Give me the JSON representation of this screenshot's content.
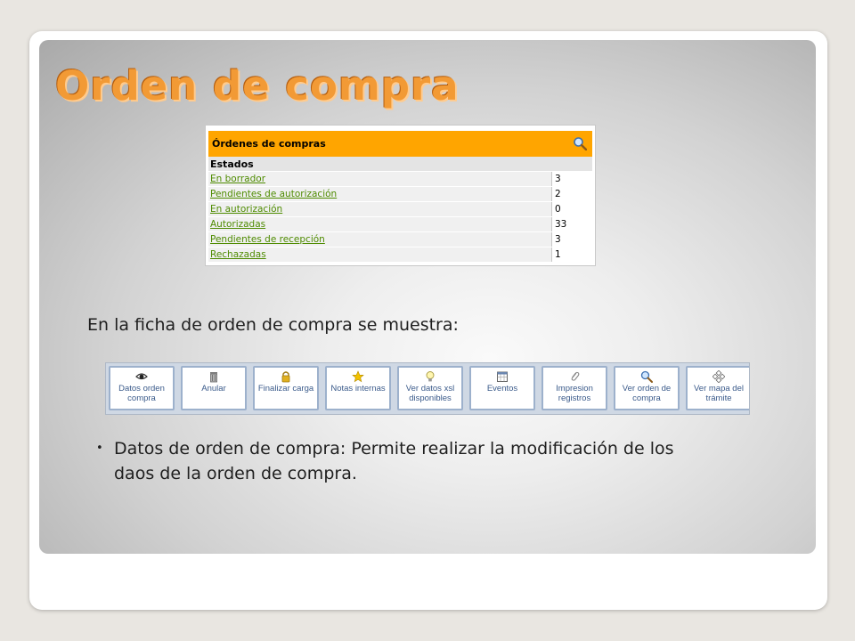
{
  "slide": {
    "title": "Orden de compra",
    "subtitle": "En la ficha de orden de compra se muestra:",
    "bullet": "Datos de orden de compra: Permite realizar la modificación de los daos de la orden de compra."
  },
  "orders_panel": {
    "title": "Órdenes de compras",
    "states_label": "Estados",
    "header_color": "#ffa500",
    "link_color": "#4e8b00",
    "rows": [
      {
        "label": "En borrador",
        "count": "3"
      },
      {
        "label": "Pendientes de autorización",
        "count": "2"
      },
      {
        "label": "En autorización",
        "count": "0"
      },
      {
        "label": "Autorizadas",
        "count": "33"
      },
      {
        "label": "Pendientes de recepción",
        "count": "3"
      },
      {
        "label": "Rechazadas",
        "count": "1"
      }
    ]
  },
  "toolbar": {
    "buttons": [
      {
        "label": "Datos orden compra",
        "icon": "eye-icon"
      },
      {
        "label": "Anular",
        "icon": "trash-icon"
      },
      {
        "label": "Finalizar carga",
        "icon": "lock-icon"
      },
      {
        "label": "Notas internas",
        "icon": "star-icon"
      },
      {
        "label": "Ver datos xsl disponibles",
        "icon": "lightbulb-icon"
      },
      {
        "label": "Eventos",
        "icon": "calendar-icon"
      },
      {
        "label": "Impresion registros",
        "icon": "paperclip-icon"
      },
      {
        "label": "Ver orden de compra",
        "icon": "magnifier-icon"
      },
      {
        "label": "Ver mapa del trámite",
        "icon": "map-icon"
      }
    ]
  },
  "colors": {
    "title": "#f29a35",
    "toolbar_text": "#3a5a8a"
  }
}
